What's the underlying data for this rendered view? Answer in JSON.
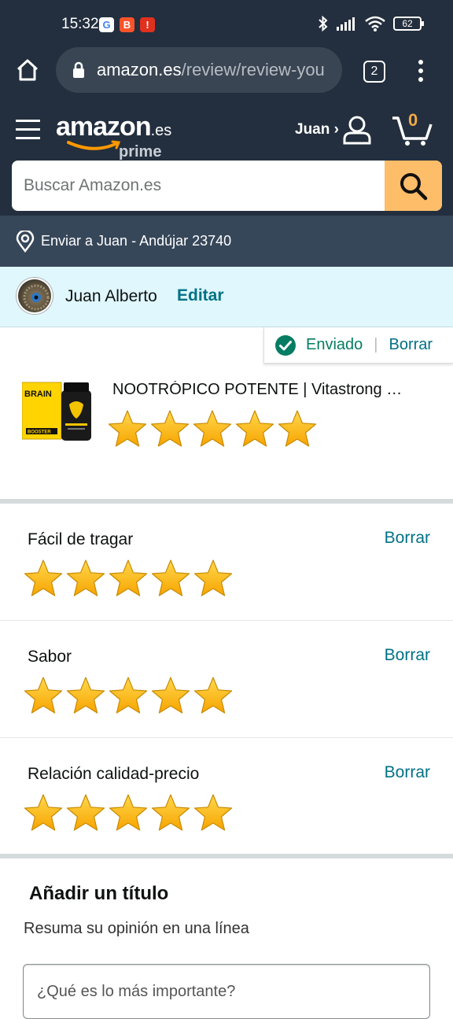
{
  "status_bar": {
    "time": "15:32",
    "battery": "62",
    "apps": [
      "G",
      "B",
      "!"
    ]
  },
  "browser": {
    "url_domain": "amazon.es",
    "url_path": "/review/review-you",
    "tab_count": "2"
  },
  "header": {
    "logo_main": "amazon",
    "logo_domain": ".es",
    "logo_prime": "prime",
    "account_name": "Juan ›",
    "cart_count": "0",
    "search_placeholder": "Buscar Amazon.es"
  },
  "delivery": {
    "text": "Enviar a Juan - Andújar 23740"
  },
  "user": {
    "name": "Juan Alberto",
    "edit_label": "Editar"
  },
  "status_badge": {
    "sent_label": "Enviado",
    "separator": "|",
    "delete_label": "Borrar"
  },
  "product": {
    "title": "NOOTRÓPICO POTENTE | Vitastrong Brain Booster",
    "rating": 5,
    "image_text": "BRAIN BOOSTER"
  },
  "ratings": [
    {
      "label": "Fácil de tragar",
      "delete_label": "Borrar",
      "stars": 5
    },
    {
      "label": "Sabor",
      "delete_label": "Borrar",
      "stars": 5
    },
    {
      "label": "Relación calidad-precio",
      "delete_label": "Borrar",
      "stars": 5
    }
  ],
  "title_section": {
    "heading": "Añadir un título",
    "subheading": "Resuma su opinión en una línea",
    "input_placeholder": "¿Qué es lo más importante?"
  },
  "colors": {
    "navy": "#232f3e",
    "search_button": "#febd69",
    "link": "#007185",
    "star": "#ffc20e",
    "success": "#067d62"
  }
}
